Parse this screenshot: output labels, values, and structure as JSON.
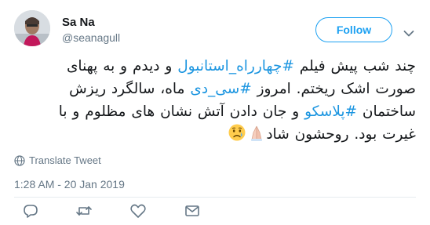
{
  "user": {
    "display_name": "Sa Na",
    "handle": "@seanagull",
    "avatar_icon": "user-avatar-photo"
  },
  "follow": {
    "label": "Follow"
  },
  "more_menu": {
    "icon": "chevron-down-icon"
  },
  "tweet": {
    "line1": {
      "pre": "چند شب پیش فیلم ",
      "hashtag": "#چهارراه_استانبول",
      "post": " و دیدم و به پهنای"
    },
    "line2": {
      "pre": "صورت اشک ریختم. امروز ",
      "hashtag": "#سی_دی",
      "post": " ماه، سالگرد ریزش"
    },
    "line3": {
      "pre": "ساختمان ",
      "hashtag": "#پلاسکو",
      "post": " و جان دادن آتش نشان های مظلوم و با"
    },
    "line4": {
      "pre": "غیرت بود. روحشون شاد",
      "emoji1": "folded-hands-icon",
      "emoji2": "crying-face-icon"
    }
  },
  "translate": {
    "label": "Translate Tweet",
    "icon": "globe-icon"
  },
  "timestamp": "1:28 AM - 20 Jan 2019",
  "actions": [
    {
      "name": "reply",
      "icon": "reply-icon"
    },
    {
      "name": "retweet",
      "icon": "retweet-icon"
    },
    {
      "name": "like",
      "icon": "heart-icon"
    },
    {
      "name": "message",
      "icon": "envelope-icon"
    }
  ],
  "colors": {
    "accent": "#1da1f2",
    "hashtag": "#1b95e0",
    "secondary_text": "#657786",
    "text": "#14171a"
  }
}
